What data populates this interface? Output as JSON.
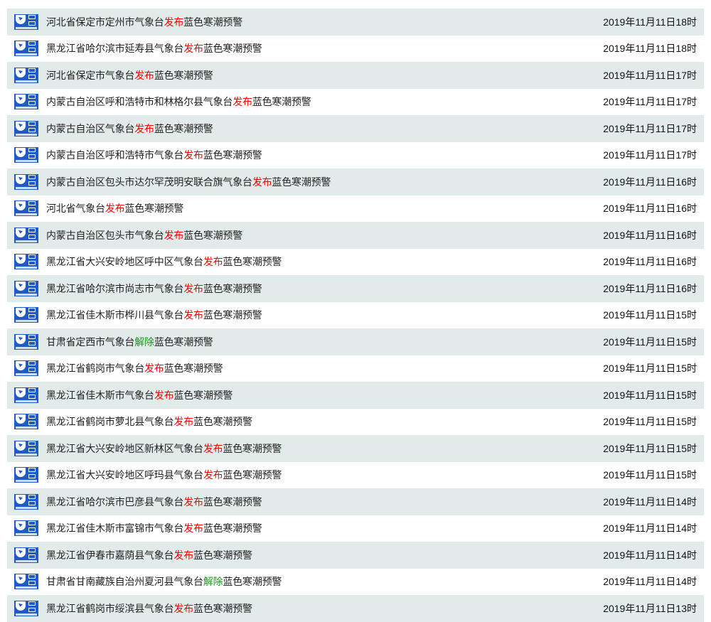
{
  "warnings": [
    {
      "prefix": "河北省保定市定州市气象台",
      "action": "发布",
      "action_type": "issue",
      "suffix": "蓝色寒潮预警",
      "time": "2019年11月11日18时",
      "icon": "cold-wave-blue-warning-icon"
    },
    {
      "prefix": "黑龙江省哈尔滨市延寿县气象台",
      "action": "发布",
      "action_type": "issue",
      "suffix": "蓝色寒潮预警",
      "time": "2019年11月11日18时",
      "icon": "cold-wave-blue-warning-icon"
    },
    {
      "prefix": "河北省保定市气象台",
      "action": "发布",
      "action_type": "issue",
      "suffix": "蓝色寒潮预警",
      "time": "2019年11月11日17时",
      "icon": "cold-wave-blue-warning-icon"
    },
    {
      "prefix": "内蒙古自治区呼和浩特市和林格尔县气象台",
      "action": "发布",
      "action_type": "issue",
      "suffix": "蓝色寒潮预警",
      "time": "2019年11月11日17时",
      "icon": "cold-wave-blue-warning-icon"
    },
    {
      "prefix": "内蒙古自治区气象台",
      "action": "发布",
      "action_type": "issue",
      "suffix": "蓝色寒潮预警",
      "time": "2019年11月11日17时",
      "icon": "cold-wave-blue-warning-icon"
    },
    {
      "prefix": "内蒙古自治区呼和浩特市气象台",
      "action": "发布",
      "action_type": "issue",
      "suffix": "蓝色寒潮预警",
      "time": "2019年11月11日17时",
      "icon": "cold-wave-blue-warning-icon"
    },
    {
      "prefix": "内蒙古自治区包头市达尔罕茂明安联合旗气象台",
      "action": "发布",
      "action_type": "issue",
      "suffix": "蓝色寒潮预警",
      "time": "2019年11月11日16时",
      "icon": "cold-wave-blue-warning-icon"
    },
    {
      "prefix": "河北省气象台",
      "action": "发布",
      "action_type": "issue",
      "suffix": "蓝色寒潮预警",
      "time": "2019年11月11日16时",
      "icon": "cold-wave-blue-warning-icon"
    },
    {
      "prefix": "内蒙古自治区包头市气象台",
      "action": "发布",
      "action_type": "issue",
      "suffix": "蓝色寒潮预警",
      "time": "2019年11月11日16时",
      "icon": "cold-wave-blue-warning-icon"
    },
    {
      "prefix": "黑龙江省大兴安岭地区呼中区气象台",
      "action": "发布",
      "action_type": "issue",
      "suffix": "蓝色寒潮预警",
      "time": "2019年11月11日16时",
      "icon": "cold-wave-blue-warning-icon"
    },
    {
      "prefix": "黑龙江省哈尔滨市尚志市气象台",
      "action": "发布",
      "action_type": "issue",
      "suffix": "蓝色寒潮预警",
      "time": "2019年11月11日16时",
      "icon": "cold-wave-blue-warning-icon"
    },
    {
      "prefix": "黑龙江省佳木斯市桦川县气象台",
      "action": "发布",
      "action_type": "issue",
      "suffix": "蓝色寒潮预警",
      "time": "2019年11月11日15时",
      "icon": "cold-wave-blue-warning-icon"
    },
    {
      "prefix": "甘肃省定西市气象台",
      "action": "解除",
      "action_type": "lift",
      "suffix": "蓝色寒潮预警",
      "time": "2019年11月11日15时",
      "icon": "cold-wave-blue-warning-icon"
    },
    {
      "prefix": "黑龙江省鹤岗市气象台",
      "action": "发布",
      "action_type": "issue",
      "suffix": "蓝色寒潮预警",
      "time": "2019年11月11日15时",
      "icon": "cold-wave-blue-warning-icon"
    },
    {
      "prefix": "黑龙江省佳木斯市气象台",
      "action": "发布",
      "action_type": "issue",
      "suffix": "蓝色寒潮预警",
      "time": "2019年11月11日15时",
      "icon": "cold-wave-blue-warning-icon"
    },
    {
      "prefix": "黑龙江省鹤岗市萝北县气象台",
      "action": "发布",
      "action_type": "issue",
      "suffix": "蓝色寒潮预警",
      "time": "2019年11月11日15时",
      "icon": "cold-wave-blue-warning-icon"
    },
    {
      "prefix": "黑龙江省大兴安岭地区新林区气象台",
      "action": "发布",
      "action_type": "issue",
      "suffix": "蓝色寒潮预警",
      "time": "2019年11月11日15时",
      "icon": "cold-wave-blue-warning-icon"
    },
    {
      "prefix": "黑龙江省大兴安岭地区呼玛县气象台",
      "action": "发布",
      "action_type": "issue",
      "suffix": "蓝色寒潮预警",
      "time": "2019年11月11日15时",
      "icon": "cold-wave-blue-warning-icon"
    },
    {
      "prefix": "黑龙江省哈尔滨市巴彦县气象台",
      "action": "发布",
      "action_type": "issue",
      "suffix": "蓝色寒潮预警",
      "time": "2019年11月11日14时",
      "icon": "cold-wave-blue-warning-icon"
    },
    {
      "prefix": "黑龙江省佳木斯市富锦市气象台",
      "action": "发布",
      "action_type": "issue",
      "suffix": "蓝色寒潮预警",
      "time": "2019年11月11日14时",
      "icon": "cold-wave-blue-warning-icon"
    },
    {
      "prefix": "黑龙江省伊春市嘉荫县气象台",
      "action": "发布",
      "action_type": "issue",
      "suffix": "蓝色寒潮预警",
      "time": "2019年11月11日14时",
      "icon": "cold-wave-blue-warning-icon"
    },
    {
      "prefix": "甘肃省甘南藏族自治州夏河县气象台",
      "action": "解除",
      "action_type": "lift",
      "suffix": "蓝色寒潮预警",
      "time": "2019年11月11日14时",
      "icon": "cold-wave-blue-warning-icon"
    },
    {
      "prefix": "黑龙江省鹤岗市绥滨县气象台",
      "action": "发布",
      "action_type": "issue",
      "suffix": "蓝色寒潮预警",
      "time": "2019年11月11日13时",
      "icon": "cold-wave-blue-warning-icon"
    }
  ],
  "colors": {
    "row_shaded": "#e1ecea",
    "row_plain": "#ffffff",
    "action_issue": "#ff0000",
    "action_lift": "#1a9a1a",
    "icon_blue": "#1e5bc6",
    "text": "#222222"
  }
}
